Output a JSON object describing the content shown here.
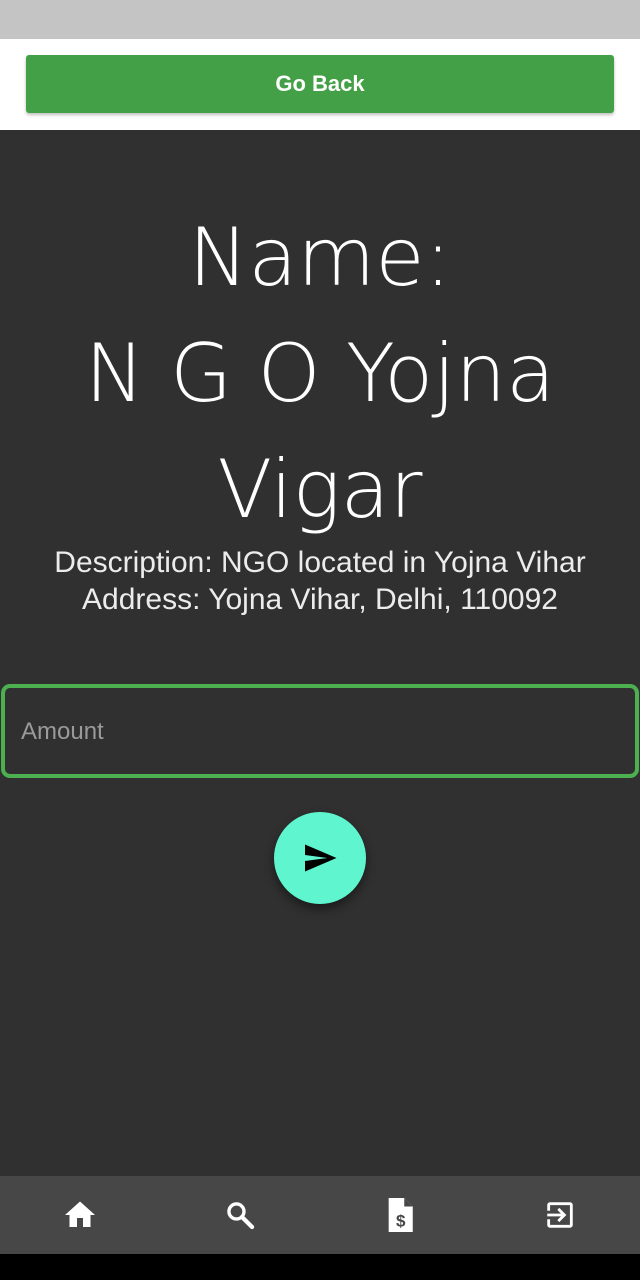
{
  "header": {
    "go_back_label": "Go Back"
  },
  "ngo": {
    "name_line1": "Name:",
    "name_line2": "N G O Yojna",
    "name_line3": "Vigar",
    "description": "Description: NGO located in Yojna Vihar",
    "address": "Address: Yojna Vihar, Delhi, 110092"
  },
  "donation": {
    "amount_value": "",
    "amount_placeholder": "Amount",
    "send_icon": "send-icon"
  },
  "bottom_nav": {
    "items": [
      {
        "icon": "home-icon"
      },
      {
        "icon": "search-icon"
      },
      {
        "icon": "invoice-dollar-icon"
      },
      {
        "icon": "logout-icon"
      }
    ]
  },
  "colors": {
    "primary_green": "#43a047",
    "input_border": "#4caf50",
    "fab": "#5ff5cf",
    "background": "#303030",
    "nav_bar": "#474747"
  }
}
